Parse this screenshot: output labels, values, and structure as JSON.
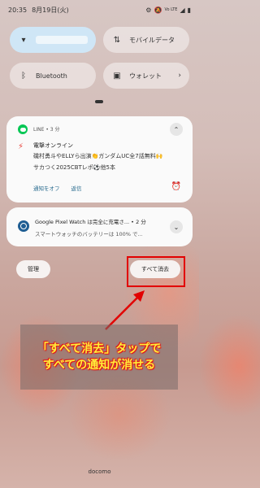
{
  "status_bar": {
    "time": "20:35",
    "date": "8月19日(火)",
    "icons": [
      "gear-icon",
      "mute-icon",
      "volte-icon",
      "signal-icon",
      "battery-icon"
    ],
    "volte_label": "Vo LTE",
    "signal": "◢",
    "battery": "▮"
  },
  "quick_settings": {
    "wifi": {
      "icon": "wifi-icon",
      "symbol": "▾",
      "active": true
    },
    "mobile_data": {
      "label": "モバイルデータ",
      "symbol": "⇅"
    },
    "bluetooth": {
      "label": "Bluetooth",
      "symbol": "ᛒ"
    },
    "wallet": {
      "label": "ウォレット",
      "symbol": "▣",
      "chevron": "›"
    }
  },
  "notifications": [
    {
      "app": "LINE",
      "age": "3 分",
      "meta_sep": " • ",
      "title": "電撃オンライン",
      "lines": [
        "磯村勇斗やELLYら出演👏ガンダムUC全7話無料🙌",
        "サカつく2025CBTレポ⚽他5本"
      ],
      "actions": [
        "通知をオフ",
        "返信"
      ],
      "expand_symbol": "⌃",
      "bolt": "⚡",
      "snooze": "⏰"
    },
    {
      "app": "Google Pixel Watch",
      "title": "Google Pixel Watch は完全に充電さ...",
      "age": "2 分",
      "meta_sep": " • ",
      "text": "スマートウォッチのバッテリーは 100% で...",
      "expand_symbol": "⌄"
    }
  ],
  "buttons": {
    "manage": "管理",
    "clear_all": "すべて消去"
  },
  "annotation": {
    "line1": "「すべて消去」タップで",
    "line2": "すべての通知が消せる",
    "color": "#e20000"
  },
  "carrier": "docomo"
}
